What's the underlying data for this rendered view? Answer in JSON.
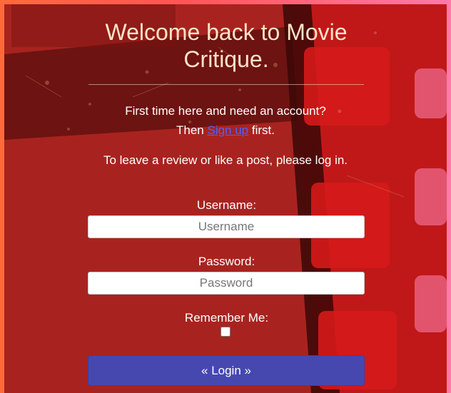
{
  "heading": {
    "title": "Welcome back to Movie Critique."
  },
  "intro": {
    "line1": "First time here and need an account?",
    "line2_prefix": "Then",
    "signup_link": "Sign up",
    "line2_suffix": "first.",
    "note": "To leave a review or like a post, please log in."
  },
  "form": {
    "username_label": "Username:",
    "username_placeholder": "Username",
    "username_value": "",
    "password_label": "Password:",
    "password_placeholder": "Password",
    "password_value": "",
    "remember_label": "Remember Me:",
    "remember_checked": false,
    "login_label": "« Login »"
  },
  "colors": {
    "background_frame": "#a9201e",
    "page_gradient_start": "#ff6a3d",
    "page_gradient_end": "#ff7aa8",
    "title_text": "#ffe3c8",
    "link": "#4a63ff",
    "button_bg": "#4648b0"
  },
  "decor": {
    "background": "film-strip-graphic"
  }
}
